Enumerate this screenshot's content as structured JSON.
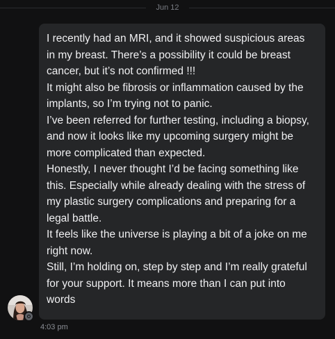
{
  "date_divider": "Jun 12",
  "message": {
    "lines": [
      "I recently had an MRI, and it showed suspicious areas",
      "in my breast. There’s a possibility it could be breast",
      "cancer, but it’s not confirmed !!!",
      "It might also be fibrosis or inflammation caused by the",
      "implants, so I’m trying not to panic.",
      "I’ve been referred for further testing, including a biopsy,",
      "and now it looks like my upcoming surgery might be",
      "more complicated than expected.",
      "Honestly, I never thought I’d be facing something like",
      "this. Especially while already dealing with the stress of",
      "my plastic surgery complications and preparing for a",
      "legal battle.",
      "It feels like the universe is playing a bit of a joke on me",
      "right now.",
      "Still, I’m holding on, step by step and I’m really grateful",
      "for your support. It means more than I can put into",
      "words"
    ],
    "timestamp": "4:03 pm"
  },
  "sender": {
    "avatar_icon": "user-avatar-photo",
    "status_icon": "presence-status-icon"
  },
  "colors": {
    "background": "#111112",
    "bubble": "#252628",
    "text": "#f0f0f2",
    "muted": "#7b7e85"
  }
}
